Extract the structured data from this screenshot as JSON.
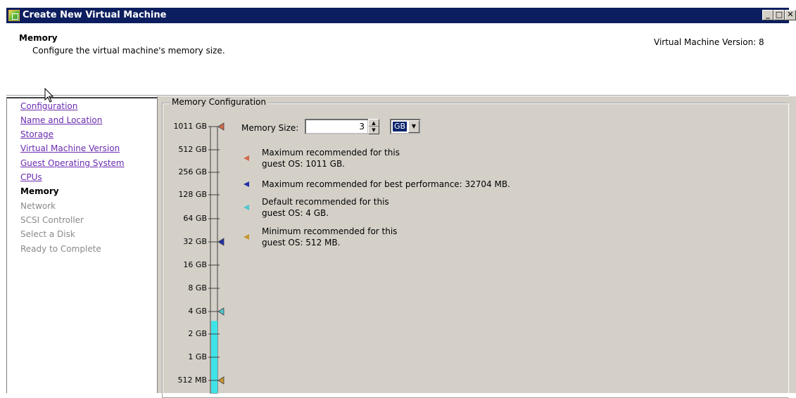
{
  "window": {
    "title": "Create New Virtual Machine",
    "minimize_glyph": "_",
    "maximize_glyph": "□",
    "close_glyph": "✕"
  },
  "header": {
    "title": "Memory",
    "subtitle": "Configure the virtual machine's memory size.",
    "version_text": "Virtual Machine Version: 8"
  },
  "nav": {
    "items": [
      {
        "label": "Configuration",
        "state": "link"
      },
      {
        "label": "Name and Location",
        "state": "link"
      },
      {
        "label": "Storage",
        "state": "link"
      },
      {
        "label": "Virtual Machine Version",
        "state": "link"
      },
      {
        "label": "Guest Operating System",
        "state": "link"
      },
      {
        "label": "CPUs",
        "state": "link"
      },
      {
        "label": "Memory",
        "state": "current"
      },
      {
        "label": "Network",
        "state": "disabled"
      },
      {
        "label": "SCSI Controller",
        "state": "disabled"
      },
      {
        "label": "Select a Disk",
        "state": "disabled"
      },
      {
        "label": "Ready to Complete",
        "state": "disabled"
      }
    ]
  },
  "memory_config": {
    "group_title": "Memory Configuration",
    "size_label": "Memory Size:",
    "size_value": "3",
    "unit_value": "GB",
    "scale": {
      "labels": [
        "1011 GB",
        "512 GB",
        "256 GB",
        "128 GB",
        "64 GB",
        "32 GB",
        "16 GB",
        "8 GB",
        "4 GB",
        "2 GB",
        "1 GB",
        "512 MB"
      ],
      "selected_fill_value": "3 GB"
    },
    "markers": [
      {
        "at": "1011 GB",
        "color": "#d2694b",
        "line1": "Maximum recommended for this",
        "line2": "guest OS: 1011 GB."
      },
      {
        "at": "32 GB",
        "color": "#1f2fa8",
        "line1": "Maximum recommended for best performance: 32704 MB.",
        "line2": ""
      },
      {
        "at": "4 GB",
        "color": "#4fc6cf",
        "line1": "Default recommended for this",
        "line2": "guest OS: 4 GB."
      },
      {
        "at": "512 MB",
        "color": "#c9952e",
        "line1": "Minimum recommended for this",
        "line2": "guest OS: 512 MB."
      }
    ],
    "fill_color": "#3ee3e8"
  }
}
